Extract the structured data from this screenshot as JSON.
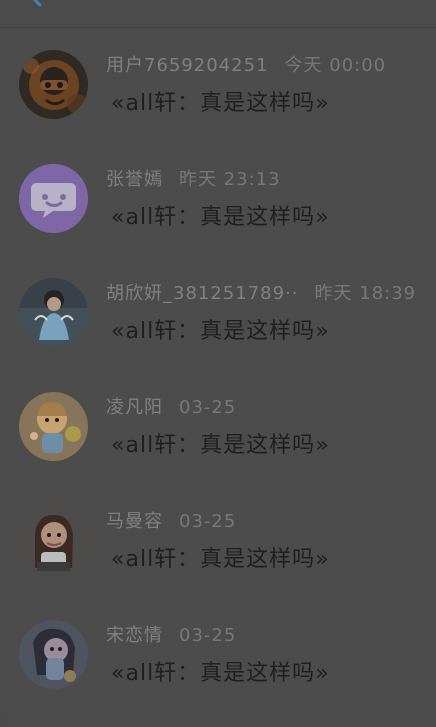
{
  "conversation_list": {
    "items": [
      {
        "name": "用户7659204251",
        "time": "今天 00:00",
        "message_prefix": "«",
        "message_body": "all轩：真是这样吗",
        "message_suffix": "»",
        "avatar_icon": "face-photo-avatar"
      },
      {
        "name": "张誉嫣",
        "time": "昨天 23:13",
        "message_prefix": "«",
        "message_body": "all轩：真是这样吗",
        "message_suffix": "»",
        "avatar_icon": "chat-bubble-avatar"
      },
      {
        "name": "胡欣妍_381251789··",
        "time": "昨天 18:39",
        "message_prefix": "«",
        "message_body": "all轩：真是这样吗",
        "message_suffix": "»",
        "avatar_icon": "doll-photo-avatar"
      },
      {
        "name": "凌凡阳",
        "time": "03-25",
        "message_prefix": "«",
        "message_body": "all轩：真是这样吗",
        "message_suffix": "»",
        "avatar_icon": "cartoon-avatar"
      },
      {
        "name": "马曼容",
        "time": "03-25",
        "message_prefix": "«",
        "message_body": "all轩：真是这样吗",
        "message_suffix": "»",
        "avatar_icon": "portrait-avatar"
      },
      {
        "name": "宋恋情",
        "time": "03-25",
        "message_prefix": "«",
        "message_body": "all轩：真是这样吗",
        "message_suffix": "»",
        "avatar_icon": "anime-avatar"
      }
    ]
  }
}
